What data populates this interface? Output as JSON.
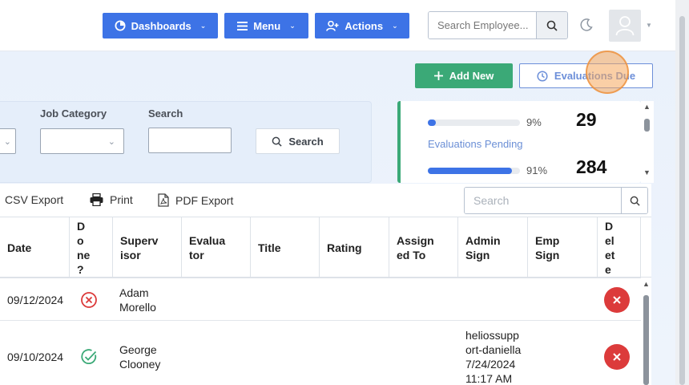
{
  "nav": {
    "dashboards": "Dashboards",
    "menu": "Menu",
    "actions": "Actions",
    "search_placeholder": "Search Employee..."
  },
  "actions": {
    "add_new": "Add New",
    "evaluations_due": "Evaluations Due"
  },
  "filters": {
    "job_category_label": "Job Category",
    "search_label": "Search",
    "search_button": "Search"
  },
  "stats": {
    "row1": {
      "percent": 9,
      "percent_label": "9%",
      "count": "29"
    },
    "pending_label": "Evaluations Pending",
    "row2": {
      "percent": 91,
      "percent_label": "91%",
      "count": "284"
    }
  },
  "toolbar": {
    "csv": "CSV Export",
    "print": "Print",
    "pdf": "PDF Export",
    "search_placeholder": "Search"
  },
  "table": {
    "headers": [
      "Date",
      "Done ?",
      "Supervisor",
      "Evaluator",
      "Title",
      "Rating",
      "Assigned To",
      "Admin Sign",
      "Emp Sign",
      "Delete"
    ],
    "header_lines": [
      [
        "Date"
      ],
      [
        "D",
        "o",
        "ne",
        "?"
      ],
      [
        "Superv",
        "isor"
      ],
      [
        "Evalua",
        "tor"
      ],
      [
        "Title"
      ],
      [
        "Rating"
      ],
      [
        "Assign",
        "ed To"
      ],
      [
        "Admin",
        "Sign"
      ],
      [
        "Emp",
        "Sign"
      ],
      [
        "D",
        "el",
        "et",
        "e"
      ]
    ],
    "rows": [
      {
        "date": "09/12/2024",
        "done": false,
        "supervisor": [
          "Adam",
          "Morello"
        ],
        "admin_sign": []
      },
      {
        "date": "09/10/2024",
        "done": true,
        "supervisor": [
          "George",
          "Clooney"
        ],
        "admin_sign": [
          "heliossupp",
          "ort-daniella",
          "7/24/2024",
          "11:17 AM"
        ]
      }
    ]
  },
  "colors": {
    "primary": "#3d73e6",
    "success": "#3ba977",
    "danger": "#dc3b3b"
  }
}
